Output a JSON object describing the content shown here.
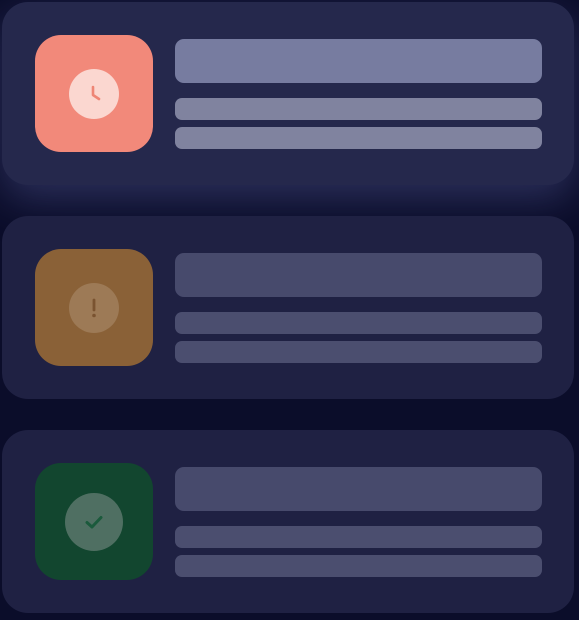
{
  "notifications": [
    {
      "status": "pending",
      "icon": "clock-icon",
      "tile_color": "#f2897a",
      "disc_color": "#fbd7d0",
      "glyph_color": "#ee8575",
      "title_bar_color": "#777ca0",
      "line_bar_color": "#80839f",
      "highlighted": true
    },
    {
      "status": "warning",
      "icon": "exclamation-icon",
      "tile_color": "#8a6137",
      "disc_color": "#9d7a56",
      "glyph_color": "#7a5330",
      "title_bar_color": "#474a6c",
      "line_bar_color": "#4b4e6f",
      "highlighted": false
    },
    {
      "status": "success",
      "icon": "checkmark-icon",
      "tile_color": "#12462f",
      "disc_color": "#4f6f62",
      "glyph_color": "#1b5a3c",
      "title_bar_color": "#474a6c",
      "line_bar_color": "#4b4e6f",
      "highlighted": false
    }
  ]
}
